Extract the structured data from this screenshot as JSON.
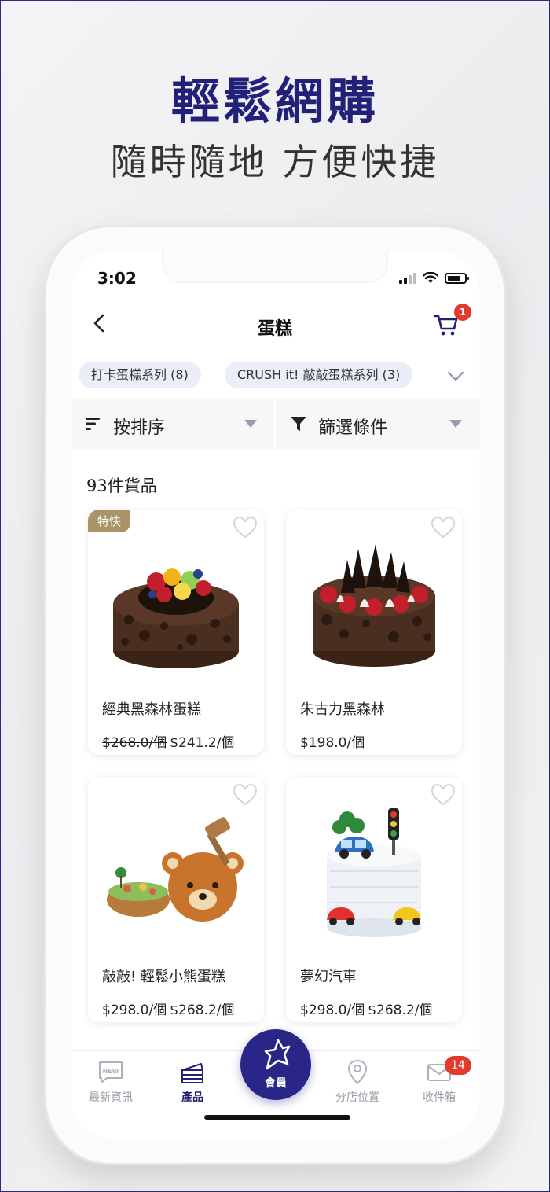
{
  "promo": {
    "headline": "輕鬆網購",
    "subheadline": "隨時隨地  方便快捷"
  },
  "status_bar": {
    "time": "3:02"
  },
  "header": {
    "title": "蛋糕",
    "cart_badge": "1"
  },
  "categories": [
    {
      "label": "打卡蛋糕系列 (8)"
    },
    {
      "label": "CRUSH it! 敲敲蛋糕系列 (3)"
    }
  ],
  "filters": {
    "sort_label": "按排序",
    "filter_label": "篩選條件"
  },
  "results": {
    "count_label": "93件貨品"
  },
  "products": [
    {
      "badge": "特快",
      "name": "經典黑森林蛋糕",
      "old_price": "$268.0/個",
      "price": "$241.2/個",
      "image": "black-forest-fruit-cake"
    },
    {
      "badge": "",
      "name": "朱古力黑森林",
      "old_price": "",
      "price": "$198.0/個",
      "image": "chocolate-black-forest-cake"
    },
    {
      "badge": "",
      "name": "敲敲! 輕鬆小熊蛋糕",
      "old_price": "$298.0/個",
      "price": "$268.2/個",
      "image": "rilakkuma-crush-cake"
    },
    {
      "badge": "",
      "name": "夢幻汽車",
      "old_price": "$298.0/個",
      "price": "$268.2/個",
      "image": "dream-car-cake"
    }
  ],
  "tabbar": {
    "news": "最新資訊",
    "products": "產品",
    "member": "會員",
    "stores": "分店位置",
    "inbox": "收件箱",
    "inbox_badge": "14"
  },
  "colors": {
    "brand": "#23207a",
    "badge_red": "#e23b2e",
    "express_badge": "#a89466"
  }
}
